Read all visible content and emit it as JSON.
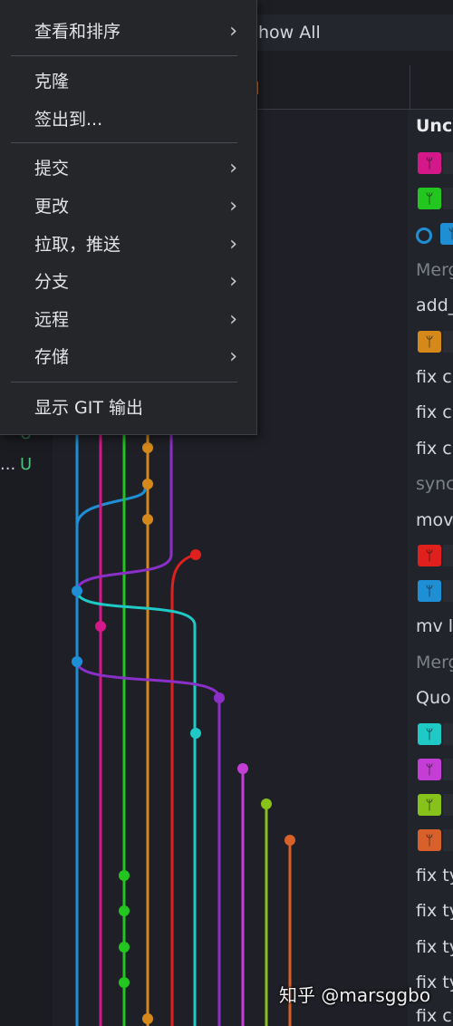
{
  "toolbar": {
    "show_all_label": "how All"
  },
  "left_panel": {
    "badge_u": "U",
    "truncated_name": "..."
  },
  "context_menu": {
    "items": [
      {
        "label": "查看和排序",
        "submenu": true
      },
      {
        "label": "克隆",
        "submenu": false
      },
      {
        "label": "签出到...",
        "submenu": false
      },
      {
        "label": "提交",
        "submenu": true
      },
      {
        "label": "更改",
        "submenu": true
      },
      {
        "label": "拉取，推送",
        "submenu": true
      },
      {
        "label": "分支",
        "submenu": true
      },
      {
        "label": "远程",
        "submenu": true
      },
      {
        "label": "存储",
        "submenu": true
      },
      {
        "label": "显示 GIT 输出",
        "submenu": false
      }
    ],
    "chevron": "›"
  },
  "commits": {
    "items": [
      {
        "text": "Unco",
        "style": "bold"
      },
      {
        "text": "Merg",
        "style": "dim"
      },
      {
        "text": "add_",
        "style": "norm"
      },
      {
        "text": "fix ci",
        "style": "norm"
      },
      {
        "text": "fix ci",
        "style": "norm"
      },
      {
        "text": "fix ci",
        "style": "norm"
      },
      {
        "text": "sync",
        "style": "dim"
      },
      {
        "text": "mov",
        "style": "norm"
      },
      {
        "text": "mv l",
        "style": "norm"
      },
      {
        "text": "Merg",
        "style": "dim"
      },
      {
        "text": "Quo",
        "style": "norm"
      },
      {
        "text": "fix ty",
        "style": "norm"
      },
      {
        "text": "fix ty",
        "style": "norm"
      },
      {
        "text": "fix ty",
        "style": "norm"
      },
      {
        "text": "fix ty",
        "style": "norm"
      },
      {
        "text": "fix ci",
        "style": "norm"
      }
    ],
    "branch_badges": [
      {
        "color": "#d4188a",
        "icon": "branch-icon"
      },
      {
        "color": "#22c61f",
        "icon": "branch-icon"
      },
      {
        "color": "#1e8fd4",
        "icon": "branch-icon"
      },
      {
        "color": "#d4891a",
        "icon": "branch-icon"
      },
      {
        "color": "#e0201c",
        "icon": "branch-icon"
      },
      {
        "color": "#1e8fd4",
        "icon": "branch-icon"
      },
      {
        "color": "#1ec9c6",
        "icon": "branch-icon"
      },
      {
        "color": "#c43ed6",
        "icon": "branch-icon"
      },
      {
        "color": "#86c21a",
        "icon": "branch-icon"
      },
      {
        "color": "#d8602a",
        "icon": "branch-icon"
      }
    ],
    "branch_glyph": "ᛘ"
  },
  "graph_colors": {
    "blue": "#1e8fd4",
    "magenta": "#d4188a",
    "green": "#22c61f",
    "orange": "#d4891a",
    "purple": "#8b2fc9",
    "red": "#e0201c",
    "cyan": "#1ec9c6",
    "pink": "#c43ed6",
    "lime": "#86c21a",
    "coral": "#d8602a"
  },
  "watermark": "知乎 @marsggbo"
}
